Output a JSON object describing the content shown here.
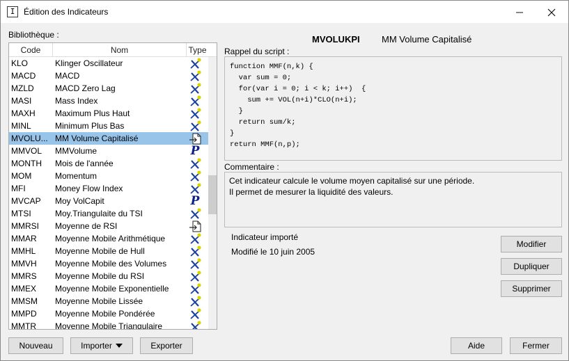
{
  "window": {
    "title": "Édition des Indicateurs",
    "icon": "I"
  },
  "library": {
    "label": "Bibliothèque :",
    "columns": [
      "Code",
      "Nom",
      "Type"
    ],
    "rows": [
      {
        "code": "KLO",
        "name": "Klinger Oscillateur",
        "type": "formula-icon"
      },
      {
        "code": "MACD",
        "name": "MACD",
        "type": "formula-icon"
      },
      {
        "code": "MZLD",
        "name": "MACD Zero Lag",
        "type": "formula-icon"
      },
      {
        "code": "MASI",
        "name": "Mass Index",
        "type": "formula-icon"
      },
      {
        "code": "MAXH",
        "name": "Maximum Plus Haut",
        "type": "formula-icon"
      },
      {
        "code": "MINL",
        "name": "Minimum Plus Bas",
        "type": "formula-icon"
      },
      {
        "code": "MVOLU...",
        "name": "MM Volume Capitalisé",
        "type": "import-icon",
        "selected": true
      },
      {
        "code": "MMVOL",
        "name": "MMVolume",
        "type": "p-icon"
      },
      {
        "code": "MONTH",
        "name": "Mois de l'année",
        "type": "formula-icon"
      },
      {
        "code": "MOM",
        "name": "Momentum",
        "type": "formula-icon"
      },
      {
        "code": "MFI",
        "name": "Money Flow Index",
        "type": "formula-icon"
      },
      {
        "code": "MVCAP",
        "name": "Moy VolCapit",
        "type": "p-icon"
      },
      {
        "code": "MTSI",
        "name": "Moy.Triangulaite du TSI",
        "type": "formula-icon"
      },
      {
        "code": "MMRSI",
        "name": "Moyenne de RSI",
        "type": "import-icon"
      },
      {
        "code": "MMAR",
        "name": "Moyenne Mobile Arithmétique",
        "type": "formula-icon"
      },
      {
        "code": "MMHL",
        "name": "Moyenne Mobile de Hull",
        "type": "formula-icon"
      },
      {
        "code": "MMVH",
        "name": "Moyenne Mobile des Volumes",
        "type": "formula-icon"
      },
      {
        "code": "MMRS",
        "name": "Moyenne Mobile du RSI",
        "type": "formula-icon"
      },
      {
        "code": "MMEX",
        "name": "Moyenne Mobile Exponentielle",
        "type": "formula-icon"
      },
      {
        "code": "MMSM",
        "name": "Moyenne Mobile Lissée",
        "type": "formula-icon"
      },
      {
        "code": "MMPD",
        "name": "Moyenne Mobile Pondérée",
        "type": "formula-icon"
      },
      {
        "code": "MMTR",
        "name": "Moyenne Mobile Triangulaire",
        "type": "formula-icon"
      }
    ]
  },
  "detail": {
    "code": "MVOLUKPI",
    "name": "MM Volume Capitalisé",
    "script_label": "Rappel du script :",
    "script_lines": [
      "function MMF(n,k) {",
      "  var sum = 0;",
      "  for(var i = 0; i < k; i++)  {",
      "    sum += VOL(n+i)*CLO(n+i);",
      "  }",
      "  return sum/k;",
      "}",
      "return MMF(n,p);"
    ],
    "comment_label": "Commentaire :",
    "comment_lines": [
      "Cet indicateur calcule le volume moyen capitalisé sur une période.",
      "Il permet de mesurer la liquidité des valeurs."
    ],
    "status": "Indicateur importé",
    "modified": "Modifié le 10 juin 2005"
  },
  "buttons": {
    "modify": "Modifier",
    "duplicate": "Dupliquer",
    "delete": "Supprimer",
    "new": "Nouveau",
    "import": "Importer",
    "export": "Exporter",
    "help": "Aide",
    "close": "Fermer"
  },
  "colors": {
    "selection": "#99c4ea",
    "formula_x": "#1a3f9e",
    "formula_dot": "#d8d400",
    "p_icon": "#0a1e8c"
  }
}
